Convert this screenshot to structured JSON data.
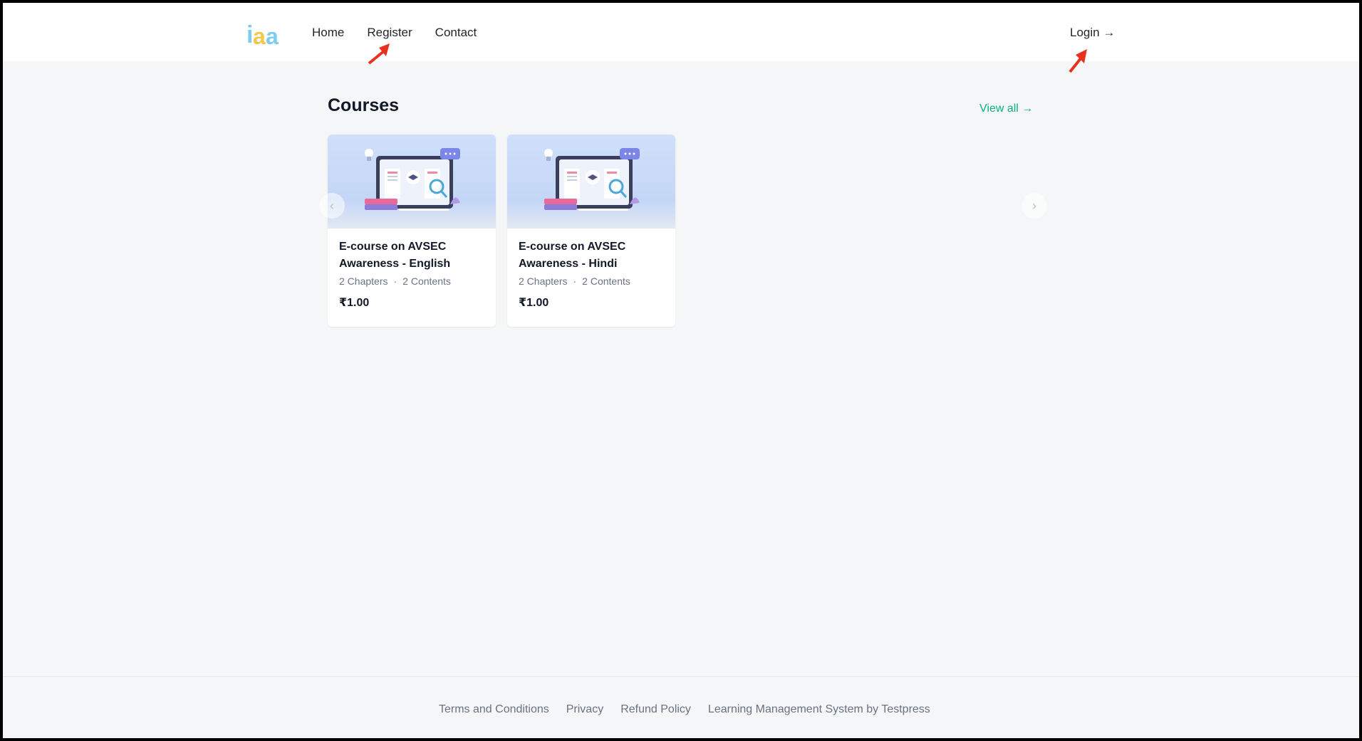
{
  "header": {
    "logo_text": "iaa",
    "nav": [
      {
        "label": "Home"
      },
      {
        "label": "Register"
      },
      {
        "label": "Contact"
      }
    ],
    "login_label": "Login →"
  },
  "courses": {
    "title": "Courses",
    "view_all_label": "View all →",
    "prev_glyph": "‹",
    "next_glyph": "›",
    "items": [
      {
        "title": "E-course on AVSEC Awareness - English",
        "chapters": "2 Chapters",
        "contents": "2 Contents",
        "price": "₹1.00"
      },
      {
        "title": "E-course on AVSEC Awareness - Hindi",
        "chapters": "2 Chapters",
        "contents": "2 Contents",
        "price": "₹1.00"
      }
    ]
  },
  "footer": {
    "links": [
      {
        "label": "Terms and Conditions"
      },
      {
        "label": "Privacy"
      },
      {
        "label": "Refund Policy"
      },
      {
        "label": "Learning Management System by Testpress"
      }
    ]
  },
  "colors": {
    "accent": "#10b27a",
    "background": "#f4f6f7",
    "annotation_arrow": "#e8321e"
  }
}
